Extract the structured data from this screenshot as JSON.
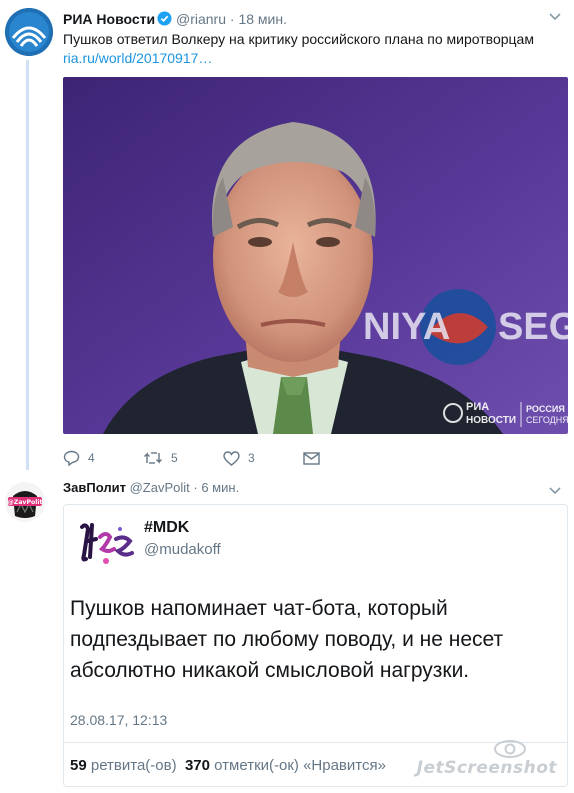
{
  "tweet1": {
    "author_name": "РИА Новости",
    "handle": "@rianru",
    "separator": "·",
    "time": "18 мин.",
    "text": "Пушков ответил Волкеру на критику российского плана по миротворцам",
    "link": "ria.ru/world/20170917…",
    "photo_watermark_line1": "РИА",
    "photo_watermark_line2": "НОВОСТИ",
    "photo_watermark_line3": "РОССИЯ",
    "photo_watermark_line4": "СЕГОДНЯ",
    "backdrop_text_left": "NIYA",
    "backdrop_text_right": "SEG",
    "counts": {
      "replies": "4",
      "retweets": "5",
      "likes": "3"
    }
  },
  "tweet2": {
    "author_name": "ЗавПолит",
    "handle": "@ZavPolit",
    "separator": "·",
    "time": "6 мин.",
    "avatar_label": "@ZavPolit",
    "quote": {
      "name": "#MDK",
      "handle": "@mudakoff",
      "text": "Пушков напоминает чат-бота, который подпездывает по любому поводу, и не несет абсолютно никакой смысловой нагрузки.",
      "date": "28.08.17, 12:13",
      "retweets_count": "59",
      "retweets_label": "ретвита(-ов)",
      "likes_count": "370",
      "likes_label": "отметки(-ок) «Нравится»"
    }
  },
  "watermark": "JetScreenshot",
  "colors": {
    "link": "#1b95e0",
    "verified": "#1da1f2",
    "muted": "#657786",
    "thread_line": "#cfe1f2",
    "photo_bg": "#4a2e86"
  }
}
